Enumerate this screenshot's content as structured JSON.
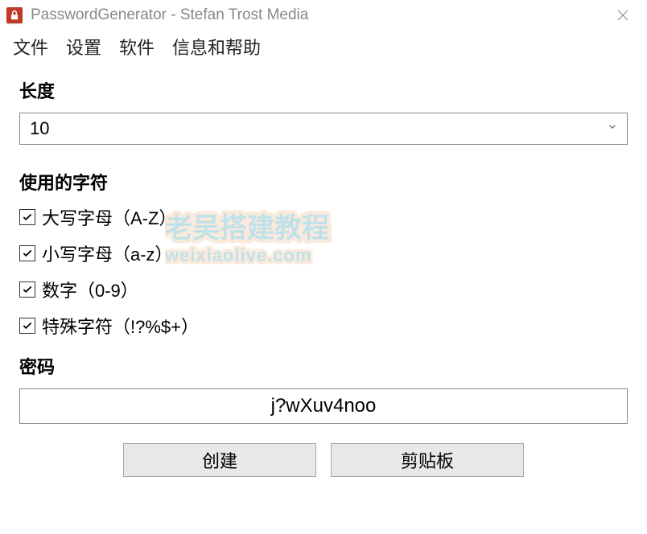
{
  "window": {
    "title": "PasswordGenerator - Stefan Trost Media",
    "icon_accent": "#c0392b"
  },
  "menu": {
    "file": "文件",
    "settings": "设置",
    "software": "软件",
    "info_help": "信息和帮助"
  },
  "length": {
    "label": "长度",
    "value": "10"
  },
  "charset": {
    "label": "使用的字符",
    "options": [
      {
        "label": "大写字母（A-Z）",
        "checked": true
      },
      {
        "label": "小写字母（a-z）",
        "checked": true
      },
      {
        "label": "数字（0-9）",
        "checked": true
      },
      {
        "label": "特殊字符（!?%$+）",
        "checked": true
      }
    ]
  },
  "password": {
    "label": "密码",
    "value": "j?wXuv4noo"
  },
  "buttons": {
    "create": "创建",
    "clipboard": "剪贴板"
  },
  "watermark": {
    "line1": "老吴搭建教程",
    "line2": "weixiaolive.com"
  }
}
